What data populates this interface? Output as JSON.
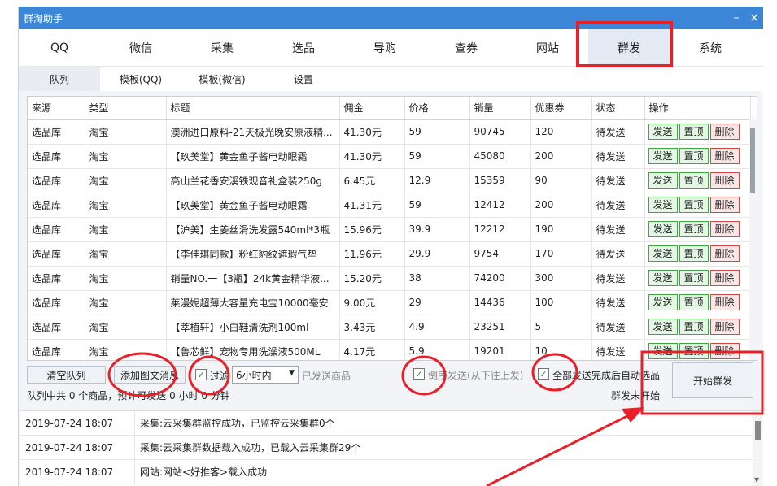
{
  "window": {
    "title": "群淘助手"
  },
  "main_tabs": [
    {
      "label": "QQ"
    },
    {
      "label": "微信"
    },
    {
      "label": "采集"
    },
    {
      "label": "选品"
    },
    {
      "label": "导购"
    },
    {
      "label": "查券"
    },
    {
      "label": "网站"
    },
    {
      "label": "群发"
    },
    {
      "label": "系统"
    }
  ],
  "main_tabs_active": "群发",
  "sub_tabs": [
    {
      "label": "队列"
    },
    {
      "label": "模板(QQ)"
    },
    {
      "label": "模板(微信)"
    },
    {
      "label": "设置"
    }
  ],
  "table": {
    "headers": [
      "来源",
      "类型",
      "标题",
      "佣金",
      "价格",
      "销量",
      "优惠券",
      "状态",
      "操作"
    ],
    "op_labels": {
      "send": "发送",
      "top": "置顶",
      "del": "删除"
    },
    "rows": [
      [
        "选品库",
        "淘宝",
        "澳洲进口原料-21天极光晚安原液精...",
        "41.30元",
        "59",
        "90745",
        "120",
        "待发送"
      ],
      [
        "选品库",
        "淘宝",
        "【玖美堂】黄金鱼子酱电动眼霜",
        "41.30元",
        "59",
        "45080",
        "200",
        "待发送"
      ],
      [
        "选品库",
        "淘宝",
        "高山兰花香安溪铁观音礼盒装250g",
        "6.45元",
        "12.9",
        "15359",
        "90",
        "待发送"
      ],
      [
        "选品库",
        "淘宝",
        "【玖美堂】黄金鱼子酱电动眼霜",
        "41.31元",
        "59",
        "12412",
        "200",
        "待发送"
      ],
      [
        "选品库",
        "淘宝",
        "【沪美】生姜丝滑洗发露540ml*3瓶",
        "15.96元",
        "39.9",
        "12212",
        "190",
        "待发送"
      ],
      [
        "选品库",
        "淘宝",
        "【李佳琪同款】粉红豹纹遮瑕气垫",
        "11.96元",
        "29.9",
        "9754",
        "170",
        "待发送"
      ],
      [
        "选品库",
        "淘宝",
        "销量NO.一【3瓶】24k黄金精华液...",
        "15.20元",
        "38",
        "74200",
        "300",
        "待发送"
      ],
      [
        "选品库",
        "淘宝",
        "莱漫妮超薄大容量充电宝10000毫安",
        "9.00元",
        "29",
        "14436",
        "100",
        "待发送"
      ],
      [
        "选品库",
        "淘宝",
        "【萃植轩】小白鞋清洗剂100ml",
        "3.43元",
        "4.9",
        "23251",
        "5",
        "待发送"
      ],
      [
        "选品库",
        "淘宝",
        "【鲁芯鲜】宠物专用洗澡液500ML",
        "4.17元",
        "5.9",
        "19201",
        "10",
        "待发送"
      ]
    ]
  },
  "controls": {
    "clear_queue": "清空队列",
    "add_msg": "添加图文消息",
    "filter_label": "过滤",
    "filter_value": "6小时内",
    "sent_goods": "已发送商品",
    "reverse_label": "倒序发送(从下往上发)",
    "shutdown_label": "全部发送完成后自动选品",
    "start_button": "开始群发",
    "status": "群发未开始",
    "queue_info": "队列中共 0 个商品，预计可发送 0 小时 0 分钟"
  },
  "log": [
    {
      "time": "2019-07-24 18:07",
      "msg": "采集:云采集群监控成功，已监控云采集群0个"
    },
    {
      "time": "2019-07-24 18:07",
      "msg": "采集:云采集群数据载入成功，已载入云采集群29个"
    },
    {
      "time": "2019-07-24 18:07",
      "msg": "网站:网站<好推客>载入成功"
    }
  ],
  "colors": {
    "titlebar": "#3b86d6",
    "annotation": "#e8202a",
    "send_btn": "#3caa3c",
    "del_btn": "#d24848"
  }
}
